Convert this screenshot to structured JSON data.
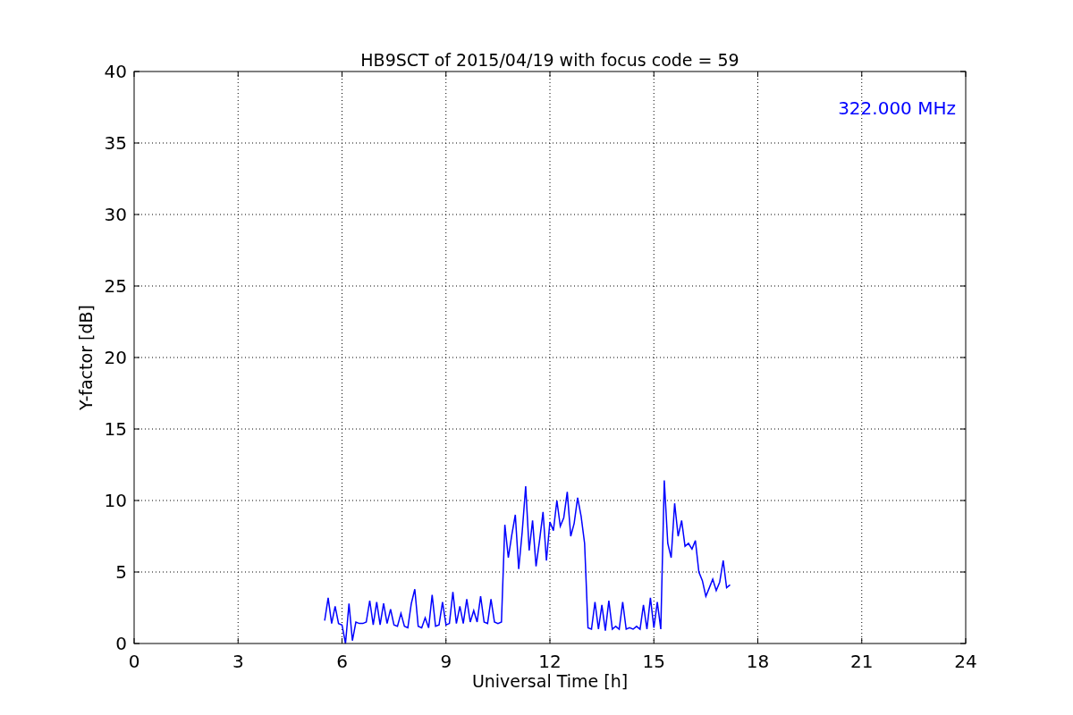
{
  "chart_data": {
    "type": "line",
    "title": "HB9SCT of 2015/04/19 with focus code = 59",
    "xlabel": "Universal Time [h]",
    "ylabel": "Y-factor [dB]",
    "x": [
      5.5,
      5.6,
      5.7,
      5.8,
      5.9,
      6.0,
      6.1,
      6.2,
      6.3,
      6.4,
      6.5,
      6.6,
      6.7,
      6.8,
      6.9,
      7.0,
      7.1,
      7.2,
      7.3,
      7.4,
      7.5,
      7.6,
      7.7,
      7.8,
      7.9,
      8.0,
      8.1,
      8.2,
      8.3,
      8.4,
      8.5,
      8.6,
      8.7,
      8.8,
      8.9,
      9.0,
      9.1,
      9.2,
      9.3,
      9.4,
      9.5,
      9.6,
      9.7,
      9.8,
      9.9,
      10.0,
      10.1,
      10.2,
      10.3,
      10.4,
      10.5,
      10.6,
      10.7,
      10.8,
      10.9,
      11.0,
      11.1,
      11.2,
      11.3,
      11.4,
      11.5,
      11.6,
      11.7,
      11.8,
      11.9,
      12.0,
      12.1,
      12.2,
      12.3,
      12.4,
      12.5,
      12.6,
      12.7,
      12.8,
      12.9,
      13.0,
      13.1,
      13.2,
      13.3,
      13.4,
      13.5,
      13.6,
      13.7,
      13.8,
      13.9,
      14.0,
      14.1,
      14.2,
      14.3,
      14.4,
      14.5,
      14.6,
      14.7,
      14.8,
      14.9,
      15.0,
      15.1,
      15.2,
      15.3,
      15.4,
      15.5,
      15.6,
      15.7,
      15.8,
      15.9,
      16.0,
      16.1,
      16.2,
      16.3,
      16.4,
      16.5,
      16.6,
      16.7,
      16.8,
      16.9,
      17.0,
      17.1,
      17.2
    ],
    "series": [
      {
        "name": "322.000 MHz",
        "color": "#0000ff",
        "values": [
          1.6,
          3.2,
          1.4,
          2.6,
          1.4,
          1.3,
          0.0,
          2.8,
          0.2,
          1.5,
          1.4,
          1.4,
          1.5,
          3.0,
          1.3,
          2.9,
          1.3,
          2.8,
          1.4,
          2.4,
          1.3,
          1.2,
          2.1,
          1.2,
          1.1,
          2.8,
          3.8,
          1.2,
          1.1,
          1.8,
          1.1,
          3.4,
          1.2,
          1.3,
          2.9,
          1.3,
          1.4,
          3.6,
          1.4,
          2.6,
          1.4,
          3.1,
          1.5,
          2.3,
          1.5,
          3.3,
          1.5,
          1.4,
          3.1,
          1.5,
          1.4,
          1.5,
          8.3,
          6.0,
          7.6,
          9.0,
          5.2,
          7.8,
          11.0,
          6.5,
          8.6,
          5.4,
          7.2,
          9.2,
          5.8,
          8.5,
          7.9,
          10.0,
          8.2,
          8.8,
          10.6,
          7.5,
          8.4,
          10.2,
          8.9,
          7.0,
          1.1,
          1.0,
          2.9,
          1.0,
          2.7,
          0.9,
          3.0,
          1.0,
          1.2,
          1.0,
          2.9,
          1.0,
          1.1,
          1.0,
          1.2,
          1.0,
          2.7,
          1.0,
          3.2,
          1.1,
          2.9,
          1.0,
          11.4,
          7.0,
          6.0,
          9.8,
          7.5,
          8.6,
          6.8,
          7.0,
          6.6,
          7.2,
          5.0,
          4.4,
          3.3,
          3.9,
          4.5,
          3.7,
          4.3,
          5.8,
          3.9,
          4.1
        ]
      }
    ],
    "grid": true,
    "xlim": [
      0,
      24
    ],
    "ylim": [
      0,
      40
    ],
    "xticks": [
      0,
      3,
      6,
      9,
      12,
      15,
      18,
      21,
      24
    ],
    "yticks": [
      0,
      5,
      10,
      15,
      20,
      25,
      30,
      35,
      40
    ]
  }
}
